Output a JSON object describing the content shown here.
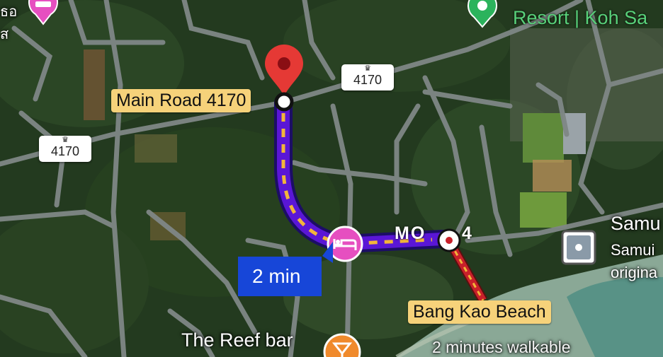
{
  "map": {
    "labels": {
      "destination": "Main Road 4170",
      "beach": "Bang Kao Beach",
      "reef_bar": "The Reef bar",
      "walk_note": "2 minutes walkable",
      "moo": "MO",
      "moo_suffix": "4",
      "resort": "Resort | Koh Sa",
      "samui": "Samu",
      "samui_sub1": "Samui",
      "samui_sub2": "origina",
      "topleft1": "ธอ",
      "topleft2": "ส"
    },
    "route_shields": [
      "4170",
      "4170"
    ],
    "travel_time": "2 min",
    "colors": {
      "route": "#5a16d6",
      "route_dash": "#f2b53a",
      "walk_route": "#c8202a",
      "pin": "#e53935",
      "hotel_marker": "#e64fc0",
      "bar_marker": "#f08a2c",
      "time_box": "#1746d8",
      "label_bg": "#f6d27a",
      "poi_green": "#2bb35c"
    },
    "icons": [
      "destination-pin-icon",
      "hotel-bed-icon",
      "cocktail-bar-icon",
      "park-poi-icon",
      "square-poi-icon",
      "location-dot-icon"
    ]
  }
}
